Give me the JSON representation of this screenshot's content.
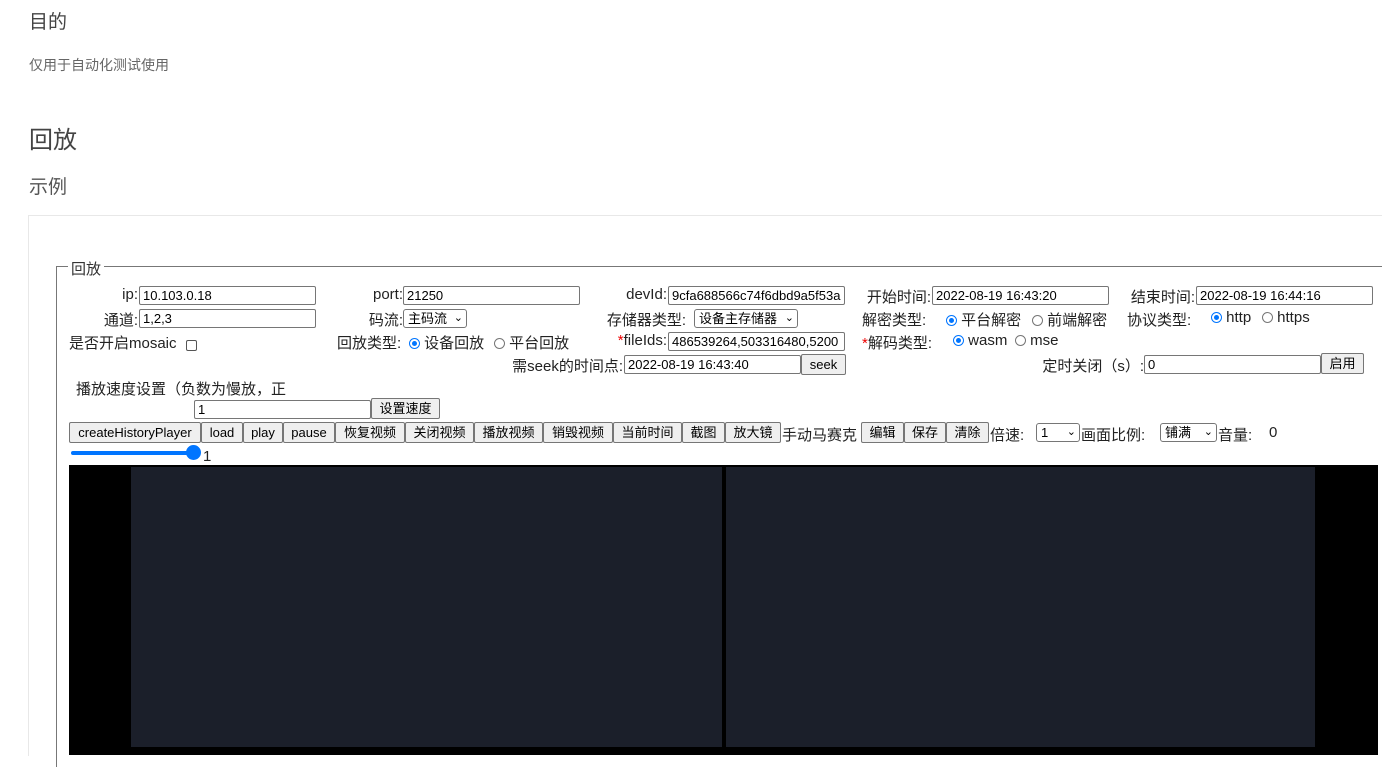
{
  "doc": {
    "purpose_heading": "目的",
    "purpose_text": "仅用于自动化测试使用",
    "playback_heading": "回放",
    "example_heading": "示例"
  },
  "form": {
    "legend": "回放",
    "ip_label": "ip:",
    "ip_value": "10.103.0.18",
    "port_label": "port:",
    "port_value": "21250",
    "devid_label": "devId:",
    "devid_value": "9cfa688566c74f6dbd9a5f53a",
    "start_label": "开始时间:",
    "start_value": "2022-08-19 16:43:20",
    "end_label": "结束时间:",
    "end_value": "2022-08-19 16:44:16",
    "channel_label": "通道:",
    "channel_value": "1,2,3",
    "stream_label": "码流:",
    "stream_value": "主码流",
    "storage_label": "存储器类型:",
    "storage_value": "设备主存储器",
    "decrypt_label": "解密类型:",
    "decrypt_options": [
      "平台解密",
      "前端解密"
    ],
    "protocol_label": "协议类型:",
    "protocol_options": [
      "http",
      "https"
    ],
    "mosaic_label": "是否开启mosaic",
    "playback_type_label": "回放类型:",
    "playback_type_options": [
      "设备回放",
      "平台回放"
    ],
    "fileids_label": "fileIds:",
    "fileids_value": "486539264,503316480,5200",
    "decode_label": "解码类型:",
    "decode_options": [
      "wasm",
      "mse"
    ],
    "seek_label": "需seek的时间点:",
    "seek_value": "2022-08-19 16:43:40",
    "seek_button": "seek",
    "timer_label": "定时关闭（s）:",
    "timer_value": "0",
    "timer_button": "启用",
    "speed_label": "播放速度设置（负数为慢放，正",
    "speed_value": "1",
    "speed_button": "设置速度"
  },
  "toolbar": {
    "buttons": [
      "createHistoryPlayer",
      "load",
      "play",
      "pause",
      "恢复视频",
      "关闭视频",
      "播放视频",
      "销毁视频",
      "当前时间",
      "截图",
      "放大镜"
    ],
    "mosaic_text": "手动马赛克",
    "mosaic_buttons": [
      "编辑",
      "保存",
      "清除"
    ],
    "rate_label": "倍速:",
    "rate_value": "1",
    "ratio_label": "画面比例:",
    "ratio_value": "铺满",
    "volume_label": "音量:",
    "volume_value": "0",
    "slider_value": "1",
    "slider_level": 1
  },
  "colors": {
    "accent": "#0075ff",
    "video_bg": "#000000",
    "pane_bg": "#1b1f2a",
    "required": "#ee0000"
  }
}
